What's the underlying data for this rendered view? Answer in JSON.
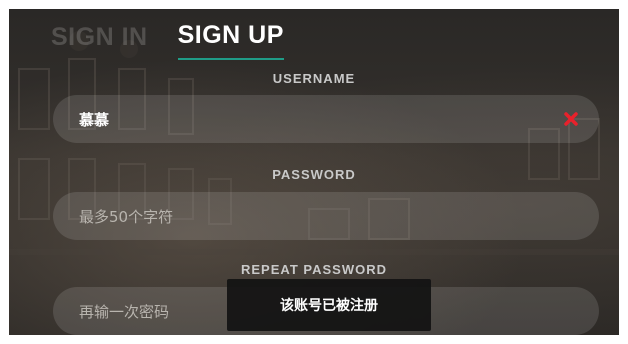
{
  "tabs": {
    "sign_in": "SIGN IN",
    "sign_up": "SIGN UP"
  },
  "form": {
    "username_label": "USERNAME",
    "username_value": "慕慕",
    "password_label": "PASSWORD",
    "password_placeholder": "最多50个字符",
    "repeat_password_label": "REPEAT PASSWORD",
    "repeat_password_placeholder": "再输一次密码"
  },
  "toast": {
    "message": "该账号已被注册"
  },
  "icons": {
    "clear": "close-icon"
  },
  "colors": {
    "accent": "#1f9c87",
    "error": "#e8212b"
  }
}
